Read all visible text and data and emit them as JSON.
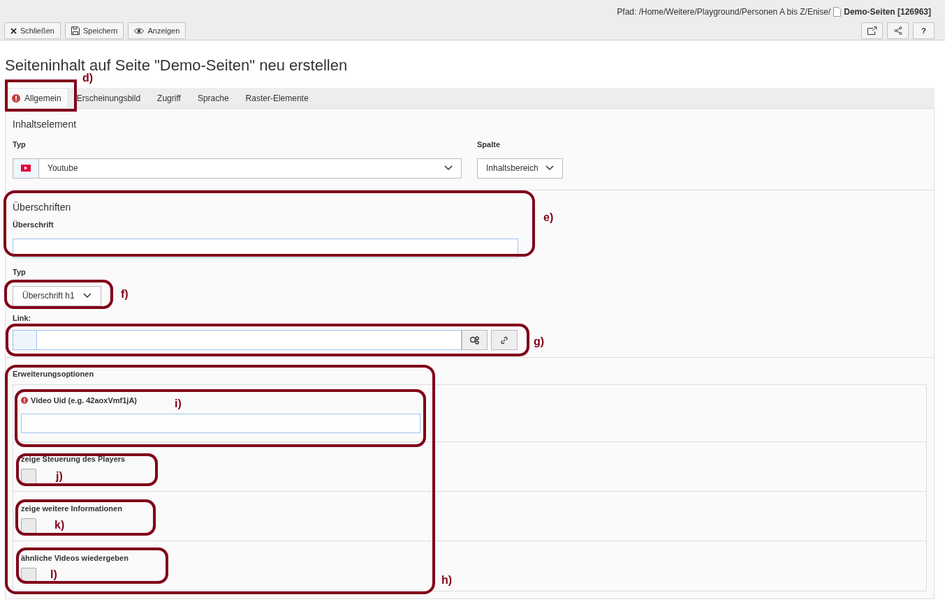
{
  "path": {
    "label": "Pfad: /Home/Weitere/Playground/Personen A bis Z/Enise/",
    "page": "Demo-Seiten [126963]"
  },
  "toolbar": [
    {
      "kind": "close",
      "label": "Schließen"
    },
    {
      "kind": "save",
      "label": "Speichern"
    },
    {
      "kind": "view",
      "label": "Anzeigen"
    }
  ],
  "toolbar_right": [
    {
      "kind": "open"
    },
    {
      "kind": "share"
    },
    {
      "kind": "help",
      "label": "?"
    }
  ],
  "title": "Seiteninhalt auf Seite \"Demo-Seiten\" neu erstellen",
  "tabs": [
    {
      "label": "Allgemein",
      "selected": true,
      "error": true
    },
    {
      "label": "Erscheinungsbild",
      "selected": false,
      "error": false
    },
    {
      "label": "Zugriff",
      "selected": false,
      "error": false
    },
    {
      "label": "Sprache",
      "selected": false,
      "error": false
    },
    {
      "label": "Raster-Elemente",
      "selected": false,
      "error": false
    }
  ],
  "content_element": {
    "heading": "Inhaltselement",
    "type_label": "Typ",
    "type_value": "Youtube",
    "column_label": "Spalte",
    "column_value": "Inhaltsbereich"
  },
  "headers": {
    "heading": "Überschriften",
    "header_label": "Überschrift",
    "type_label": "Typ",
    "type_value": "Überschrift h1",
    "link_label": "Link:"
  },
  "extension": {
    "heading": "Erweiterungsoptionen",
    "video_uid_label": "Video Uid (e.g. 42aoxVmf1jA)",
    "video_uid_error": true,
    "options": [
      {
        "label": "zeige Steuerung des Players",
        "checked": false
      },
      {
        "label": "zeige weitere Informationen",
        "checked": false
      },
      {
        "label": "ähnliche Videos wiedergeben",
        "checked": false
      }
    ]
  },
  "annotations": [
    {
      "label": "d)"
    },
    {
      "label": "e)"
    },
    {
      "label": "f)"
    },
    {
      "label": "g)"
    },
    {
      "label": "h)"
    },
    {
      "label": "i)"
    },
    {
      "label": "j)"
    },
    {
      "label": "k)"
    },
    {
      "label": "l)"
    }
  ]
}
